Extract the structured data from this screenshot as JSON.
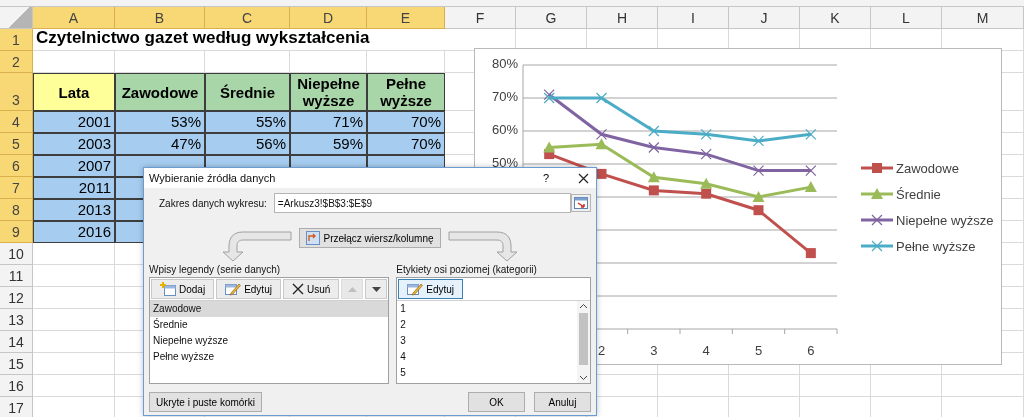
{
  "sheet": {
    "columns": [
      {
        "label": "A",
        "highlighted": true
      },
      {
        "label": "B",
        "highlighted": true
      },
      {
        "label": "C",
        "highlighted": true
      },
      {
        "label": "D",
        "highlighted": true
      },
      {
        "label": "E",
        "highlighted": true
      },
      {
        "label": "F",
        "highlighted": false
      },
      {
        "label": "G",
        "highlighted": false
      },
      {
        "label": "H",
        "highlighted": false
      },
      {
        "label": "I",
        "highlighted": false
      },
      {
        "label": "J",
        "highlighted": false
      },
      {
        "label": "K",
        "highlighted": false
      },
      {
        "label": "L",
        "highlighted": false
      },
      {
        "label": "M",
        "highlighted": false
      }
    ],
    "rows": [
      {
        "label": "1",
        "highlighted": true
      },
      {
        "label": "2",
        "highlighted": true
      },
      {
        "label": "3",
        "highlighted": true
      },
      {
        "label": "4",
        "highlighted": true
      },
      {
        "label": "5",
        "highlighted": true
      },
      {
        "label": "6",
        "highlighted": true
      },
      {
        "label": "7",
        "highlighted": true
      },
      {
        "label": "8",
        "highlighted": true
      },
      {
        "label": "9",
        "highlighted": true
      },
      {
        "label": "10",
        "highlighted": false
      },
      {
        "label": "11",
        "highlighted": false
      },
      {
        "label": "12",
        "highlighted": false
      },
      {
        "label": "13",
        "highlighted": false
      },
      {
        "label": "14",
        "highlighted": false
      },
      {
        "label": "15",
        "highlighted": false
      },
      {
        "label": "16",
        "highlighted": false
      },
      {
        "label": "17",
        "highlighted": false
      }
    ]
  },
  "title": "Czytelnictwo gazet według wykształcenia",
  "table": {
    "headers": [
      "Lata",
      "Zawodowe",
      "Średnie",
      "Niepełne wyższe",
      "Pełne wyższe"
    ],
    "rows": [
      [
        "2001",
        "53%",
        "55%",
        "71%",
        "70%"
      ],
      [
        "2003",
        "47%",
        "56%",
        "59%",
        "70%"
      ],
      [
        "2007"
      ],
      [
        "2011"
      ],
      [
        "2013"
      ],
      [
        "2016"
      ]
    ]
  },
  "chart": {
    "chart_data": {
      "type": "line",
      "x": [
        1,
        2,
        3,
        4,
        5,
        6
      ],
      "xlim": [
        0.5,
        6.5
      ],
      "xticks": [
        {
          "value": 2,
          "label": "2"
        },
        {
          "value": 3,
          "label": "3"
        },
        {
          "value": 4,
          "label": "4"
        },
        {
          "value": 5,
          "label": "5"
        },
        {
          "value": 6,
          "label": "6"
        }
      ],
      "ylim": [
        0,
        80
      ],
      "yticks": [
        {
          "value": 50,
          "label": "50%"
        },
        {
          "value": 60,
          "label": "60%"
        },
        {
          "value": 70,
          "label": "70%"
        },
        {
          "value": 80,
          "label": "80%"
        }
      ],
      "grid": true,
      "legend": true,
      "series": [
        {
          "name": "Zawodowe",
          "color": "#c0504d",
          "marker": "square",
          "values": [
            53,
            47,
            42,
            41,
            36,
            23
          ]
        },
        {
          "name": "Średnie",
          "color": "#9bbb59",
          "marker": "triangle",
          "values": [
            55,
            56,
            46,
            44,
            40,
            43
          ]
        },
        {
          "name": "Niepełne wyższe",
          "color": "#8064a2",
          "marker": "cross",
          "values": [
            71,
            59,
            55,
            53,
            48,
            48
          ]
        },
        {
          "name": "Pełne wyższe",
          "color": "#4bacc6",
          "marker": "cross",
          "values": [
            70,
            70,
            60,
            59,
            57,
            59
          ]
        }
      ]
    }
  },
  "dialog": {
    "title": "Wybieranie źródła danych",
    "help": "?",
    "range_label": "Zakres danych wykresu:",
    "range_value": "=Arkusz3!$B$3:$E$9",
    "switch_button": "Przełącz wiersz/kolumnę",
    "legend_pane": {
      "label": "Wpisy legendy (serie danych)",
      "buttons": [
        {
          "label": "Dodaj",
          "kind": "add"
        },
        {
          "label": "Edytuj",
          "kind": "edit"
        },
        {
          "label": "Usuń",
          "kind": "remove"
        }
      ],
      "move_up": {
        "disabled": true
      },
      "move_down": {
        "disabled": false
      },
      "items": [
        {
          "label": "Zawodowe",
          "selected": true
        },
        {
          "label": "Średnie",
          "selected": false
        },
        {
          "label": "Niepełne wyższe",
          "selected": false
        },
        {
          "label": "Pełne wyższe",
          "selected": false
        }
      ]
    },
    "axis_pane": {
      "label": "Etykiety osi poziomej (kategorii)",
      "edit_button": "Edytuj",
      "items": [
        {
          "label": "1"
        },
        {
          "label": "2"
        },
        {
          "label": "3"
        },
        {
          "label": "4"
        },
        {
          "label": "5"
        }
      ]
    },
    "hidden_cells_button": "Ukryte i puste komórki",
    "ok_button": "OK",
    "cancel_button": "Anuluj"
  }
}
